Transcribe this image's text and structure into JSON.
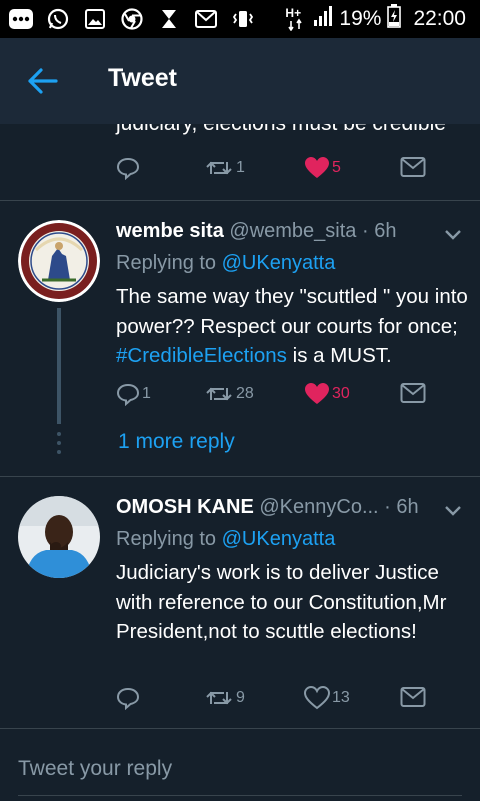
{
  "status_bar": {
    "icons": [
      "bbm-icon",
      "whatsapp-icon",
      "gallery-icon",
      "chrome-icon",
      "hourglass-icon",
      "gmail-icon",
      "vibrate-icon",
      "network-icon",
      "signal-icon",
      "battery-icon"
    ],
    "network_label": "H+",
    "battery": "19%",
    "time": "22:00"
  },
  "header": {
    "title": "Tweet",
    "back_icon": "arrow-left-icon"
  },
  "colors": {
    "accent": "#1da1f2",
    "like": "#e0245e",
    "background": "#15202b",
    "header": "#1c2938",
    "muted": "#8899a6"
  },
  "previous_tweet": {
    "cut_text": "judiciary, elections must be credible",
    "retweets": "1",
    "likes": "5"
  },
  "tweets": [
    {
      "name": "wembe sita",
      "handle": "@wembe_sita",
      "time": "· 6h",
      "replying_prefix": "Replying to",
      "replying_to": "@UKenyatta",
      "body_before": "The same way they \"scuttled \" you into power?? Respect our courts for once; ",
      "hashtag": "#CredibleElections",
      "body_after": " is a MUST.",
      "replies": "1",
      "retweets": "28",
      "likes": "30",
      "more_replies": "1 more reply"
    },
    {
      "name": "OMOSH KANE",
      "handle": "@KennyCo...",
      "time": "· 6h",
      "replying_prefix": "Replying to",
      "replying_to": "@UKenyatta",
      "body": "Judiciary's work is to deliver Justice with reference to our Constitution,Mr President,not to scuttle elections!",
      "replies": "",
      "retweets": "9",
      "likes": "13"
    }
  ],
  "reply_bar": {
    "placeholder": "Tweet your reply"
  }
}
